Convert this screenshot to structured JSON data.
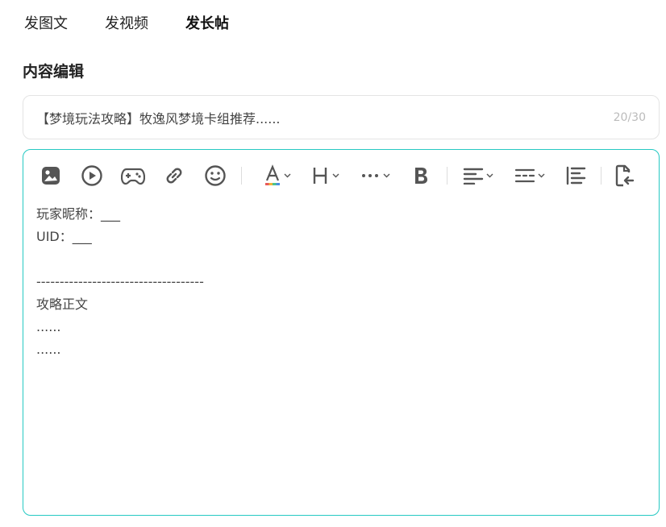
{
  "tabs": [
    {
      "label": "发图文"
    },
    {
      "label": "发视频"
    },
    {
      "label": "发长帖"
    }
  ],
  "section_title": "内容编辑",
  "title_field": {
    "value": "【梦境玩法攻略】牧逸风梦境卡组推荐......",
    "counter": "20/30"
  },
  "toolbar": {
    "icons": [
      "image-icon",
      "video-icon",
      "gamepad-icon",
      "link-icon",
      "emoji-icon",
      "font-color-icon",
      "heading-icon",
      "more-icon",
      "bold-icon",
      "align-icon",
      "line-spacing-icon",
      "indent-icon",
      "paste-format-icon"
    ],
    "accent": "#26c9c3"
  },
  "content": {
    "lines": [
      "玩家昵称：___",
      "UID：___",
      "",
      "------------------------------------",
      "攻略正文",
      "......",
      "......"
    ]
  },
  "colors": {
    "accent": "#26c9c3",
    "tab_highlight": "#1fd1c2"
  }
}
